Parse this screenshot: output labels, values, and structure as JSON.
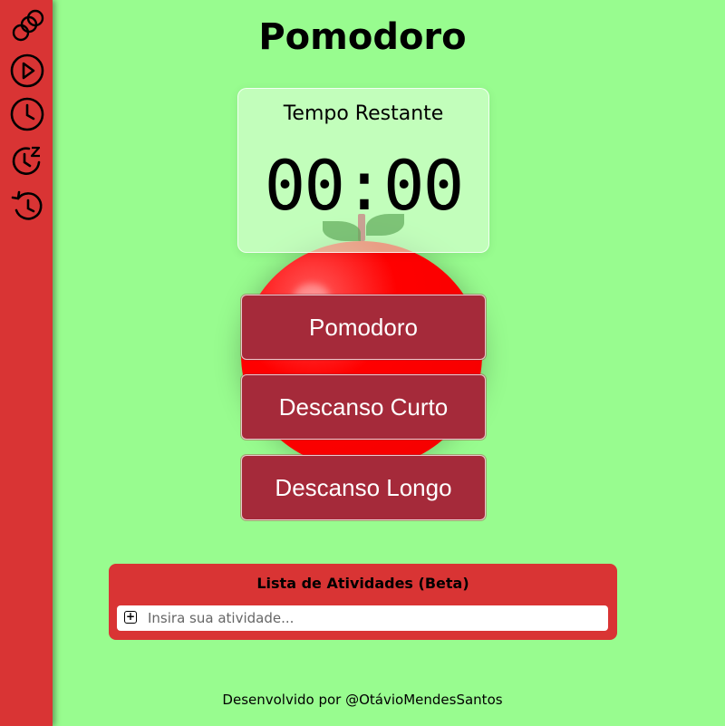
{
  "sidebar": {
    "icons": [
      {
        "name": "tomato-logo-icon"
      },
      {
        "name": "play-icon"
      },
      {
        "name": "clock-icon"
      },
      {
        "name": "sleep-clock-icon"
      },
      {
        "name": "history-icon"
      }
    ]
  },
  "header": {
    "title": "Pomodoro"
  },
  "timer": {
    "label": "Tempo Restante",
    "value": "00:00"
  },
  "modes": {
    "pomodoro": "Pomodoro",
    "short_break": "Descanso Curto",
    "long_break": "Descanso Longo"
  },
  "tasks": {
    "title": "Lista de Atividades (Beta)",
    "add_label": "+",
    "input_value": "",
    "placeholder": "Insira sua atividade..."
  },
  "footer": {
    "text": "Desenvolvido por @OtávioMendesSantos"
  },
  "colors": {
    "background": "#98fc8f",
    "sidebar": "#d93434",
    "button": "#a52a3a",
    "apple": "#ff0000"
  }
}
